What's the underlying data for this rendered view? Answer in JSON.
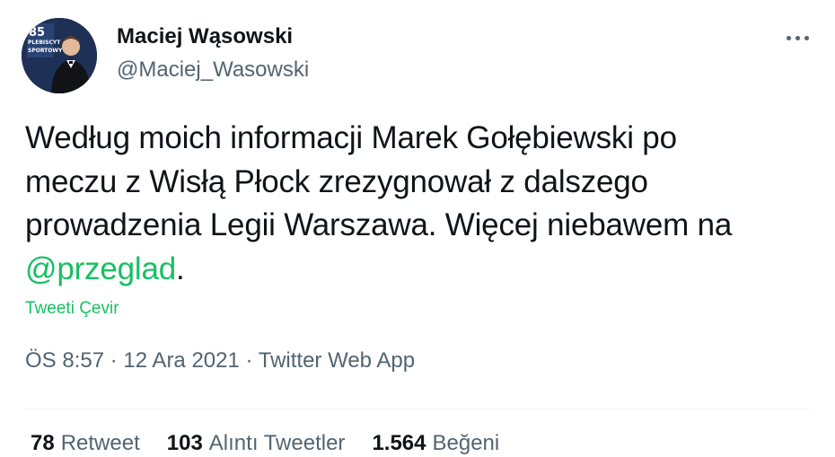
{
  "author": {
    "display_name": "Maciej Wąsowski",
    "handle": "@Maciej_Wasowski",
    "avatar_badge": "85 PLEBISCYT SPORTOWY"
  },
  "more_icon": "more-horizontal-icon",
  "tweet": {
    "line1": "Według moich informacji Marek Gołębiewski po",
    "line2": "meczu z Wisłą Płock zrezygnował z dalszego",
    "line3": "prowadzenia Legii Warszawa. Więcej niebawem na",
    "mention": "@przeglad",
    "after_mention": ".",
    "translate_label": "Tweeti Çevir"
  },
  "meta": {
    "time": "ÖS 8:57",
    "sep1": " · ",
    "date": "12 Ara 2021",
    "sep2": " · ",
    "source": "Twitter Web App"
  },
  "stats": {
    "retweets_count": "78",
    "retweets_label": "Retweet",
    "quotes_count": "103",
    "quotes_label": "Alıntı Tweetler",
    "likes_count": "1.564",
    "likes_label": "Beğeni"
  },
  "colors": {
    "accent": "#17bf63",
    "text": "#0f1419",
    "secondary": "#536471"
  }
}
